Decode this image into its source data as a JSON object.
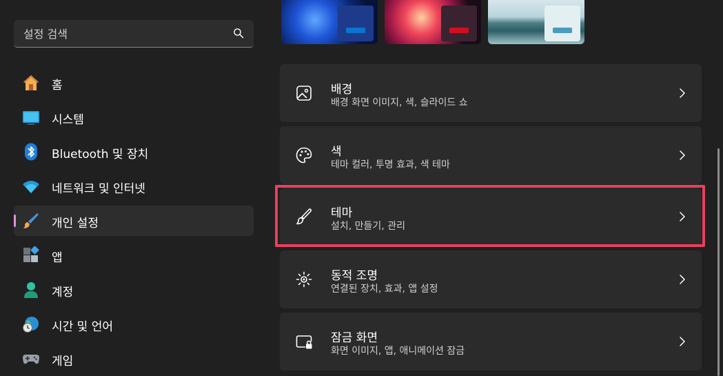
{
  "search": {
    "placeholder": "설정 검색"
  },
  "sidebar": {
    "items": [
      {
        "label": "홈",
        "icon": "home-icon"
      },
      {
        "label": "시스템",
        "icon": "system-icon"
      },
      {
        "label": "Bluetooth 및 장치",
        "icon": "bluetooth-icon"
      },
      {
        "label": "네트워크 및 인터넷",
        "icon": "wifi-icon"
      },
      {
        "label": "개인 설정",
        "icon": "brush-icon",
        "selected": true
      },
      {
        "label": "앱",
        "icon": "apps-icon"
      },
      {
        "label": "계정",
        "icon": "account-icon"
      },
      {
        "label": "시간 및 언어",
        "icon": "globe-clock-icon"
      },
      {
        "label": "게임",
        "icon": "gamepad-icon"
      }
    ]
  },
  "wallpapers": [
    {
      "name": "windows-bloom-dark",
      "accent": "#0a74d0"
    },
    {
      "name": "glow-red",
      "accent": "#d10f1e"
    },
    {
      "name": "lake-light",
      "accent": "#4a9bbf"
    }
  ],
  "cards": [
    {
      "title": "배경",
      "subtitle": "배경 화면 이미지, 색, 슬라이드 쇼",
      "icon": "image-icon"
    },
    {
      "title": "색",
      "subtitle": "테마 컬러, 투명 효과, 색 테마",
      "icon": "palette-icon"
    },
    {
      "title": "테마",
      "subtitle": "설치, 만들기, 관리",
      "icon": "brush-icon"
    },
    {
      "title": "동적 조명",
      "subtitle": "연결된 장치, 효과, 앱 설정",
      "icon": "dynamic-lighting-icon"
    },
    {
      "title": "잠금 화면",
      "subtitle": "화면 이미지, 앱, 애니메이션 잠금",
      "icon": "lock-screen-icon"
    }
  ],
  "colors": {
    "background": "#202020",
    "card": "#2b2b2b",
    "selection_indicator": "#e290d9",
    "highlight_box": "#e8405e"
  }
}
